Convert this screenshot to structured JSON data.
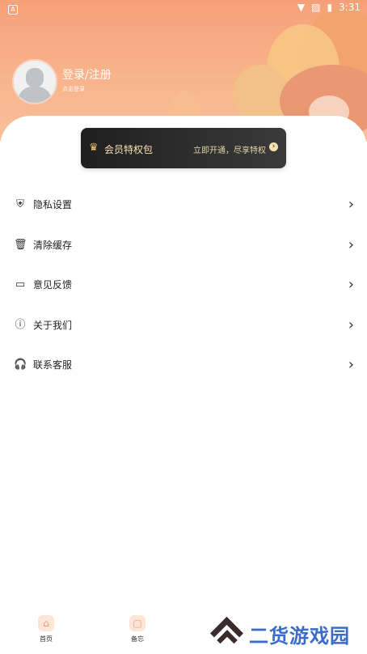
{
  "status_bar": {
    "time": "3:31",
    "app_indicator": "A"
  },
  "profile": {
    "title": "登录/注册",
    "subtitle": "点击登录"
  },
  "vip": {
    "title": "会员特权包",
    "cta": "立即开通，尽享特权"
  },
  "menu": {
    "items": [
      {
        "label": "隐私设置",
        "icon": "shield-icon"
      },
      {
        "label": "清除缓存",
        "icon": "trash-icon"
      },
      {
        "label": "意见反馈",
        "icon": "message-icon"
      },
      {
        "label": "关于我们",
        "icon": "info-icon"
      },
      {
        "label": "联系客服",
        "icon": "headset-icon"
      }
    ]
  },
  "bottom_nav": {
    "items": [
      {
        "label": "首页",
        "icon": "home-icon"
      },
      {
        "label": "备忘",
        "icon": "note-icon"
      }
    ]
  },
  "watermark": {
    "text": "二货游戏园"
  },
  "colors": {
    "hero_top": "#f6a079",
    "hero_bottom": "#f9c09a",
    "vip_bg": "#1f1f1f",
    "vip_text": "#f7e3b2",
    "accent": "#f39a73",
    "watermark_blue": "#3b6cc8"
  }
}
